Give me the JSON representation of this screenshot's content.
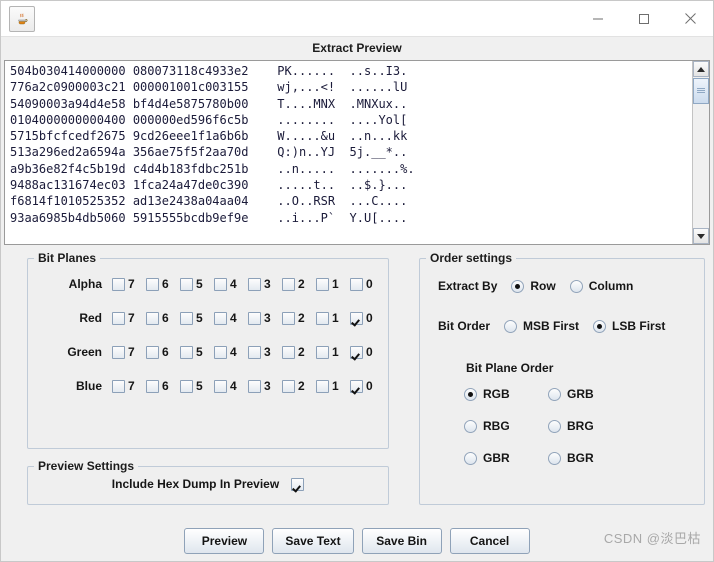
{
  "window": {
    "app_icon": "java-coffee-cup-icon",
    "minimize_label": "—",
    "maximize_label": "☐",
    "close_label": "✕"
  },
  "dialog": {
    "title": "Extract Preview"
  },
  "hex_preview": {
    "lines": [
      "504b030414000000 080073118c4933e2    PK......  ..s..I3.",
      "776a2c0900003c21 000001001c003155    wj,...<!  ......lU",
      "54090003a94d4e58 bf4d4e5875780b00    T....MNX  .MNXux..",
      "0104000000000400 000000ed596f6c5b    ........  ....Yol[",
      "5715bfcfcedf2675 9cd26eee1f1a6b6b    W.....&u  ..n...kk",
      "513a296ed2a6594a 356ae75f5f2aa70d    Q:)n..YJ  5j.__*..",
      "a9b36e82f4c5b19d c4d4b183fdbc251b    ..n.....  .......%.",
      "9488ac131674ec03 1fca24a47de0c390    .....t..  ..$.}...",
      "f6814f1010525352 ad13e2438a04aa04    ..O..RSR  ...C....",
      "93aa6985b4db5060 5915555bcdb9ef9e    ..i...P`  Y.U[...."
    ],
    "scrollbar": {
      "up_arrow": "scroll-up-icon",
      "down_arrow": "scroll-down-icon"
    }
  },
  "bit_planes": {
    "legend": "Bit Planes",
    "bit_labels": [
      "7",
      "6",
      "5",
      "4",
      "3",
      "2",
      "1",
      "0"
    ],
    "rows": [
      {
        "name": "Alpha",
        "checked": [
          false,
          false,
          false,
          false,
          false,
          false,
          false,
          false
        ]
      },
      {
        "name": "Red",
        "checked": [
          false,
          false,
          false,
          false,
          false,
          false,
          false,
          true
        ]
      },
      {
        "name": "Green",
        "checked": [
          false,
          false,
          false,
          false,
          false,
          false,
          false,
          true
        ]
      },
      {
        "name": "Blue",
        "checked": [
          false,
          false,
          false,
          false,
          false,
          false,
          false,
          true
        ]
      }
    ]
  },
  "preview_settings": {
    "legend": "Preview Settings",
    "include_hex_dump_label": "Include Hex Dump In Preview",
    "include_hex_dump_checked": true
  },
  "order_settings": {
    "legend": "Order settings",
    "extract_by_label": "Extract By",
    "extract_by_options": [
      {
        "label": "Row",
        "selected": true
      },
      {
        "label": "Column",
        "selected": false
      }
    ],
    "bit_order_label": "Bit Order",
    "bit_order_options": [
      {
        "label": "MSB First",
        "selected": false
      },
      {
        "label": "LSB First",
        "selected": true
      }
    ],
    "bit_plane_order_label": "Bit Plane Order",
    "bit_plane_order_options": [
      {
        "label": "RGB",
        "selected": true
      },
      {
        "label": "GRB",
        "selected": false
      },
      {
        "label": "RBG",
        "selected": false
      },
      {
        "label": "BRG",
        "selected": false
      },
      {
        "label": "GBR",
        "selected": false
      },
      {
        "label": "BGR",
        "selected": false
      }
    ]
  },
  "buttons": [
    {
      "label": "Preview"
    },
    {
      "label": "Save Text"
    },
    {
      "label": "Save Bin"
    },
    {
      "label": "Cancel"
    }
  ],
  "watermark": {
    "text": "CSDN @淡巴枯"
  },
  "colors": {
    "panel_bg": "#efefef",
    "window_bg": "#f0f0f0",
    "text_area_bg": "#ffffff",
    "hex_text": "#1b1b3a",
    "border": "#c0cbd8",
    "watermark": "#a8a8a8"
  }
}
